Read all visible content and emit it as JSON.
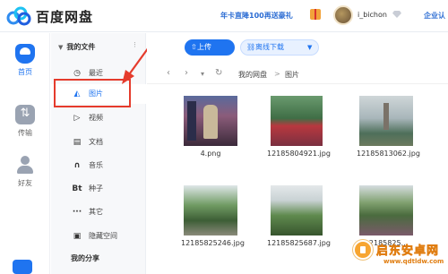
{
  "app": {
    "brand": "百度网盘",
    "promo": "年卡直降100再送豪礼",
    "username": "i_bichon",
    "enterprise": "企业认"
  },
  "rail": {
    "items": [
      {
        "label": "首页",
        "icon": "home-cloud-icon",
        "active": true
      },
      {
        "label": "传输",
        "icon": "transfer-icon",
        "active": false
      },
      {
        "label": "好友",
        "icon": "friends-icon",
        "active": false
      }
    ]
  },
  "nav": {
    "my_files": "我的文件",
    "items": [
      {
        "label": "最近",
        "icon": "clock-icon",
        "glyph": "◷"
      },
      {
        "label": "图片",
        "icon": "picture-icon",
        "glyph": "◭",
        "active": true
      },
      {
        "label": "视频",
        "icon": "play-icon",
        "glyph": "▷"
      },
      {
        "label": "文档",
        "icon": "document-icon",
        "glyph": "▤"
      },
      {
        "label": "音乐",
        "icon": "headphones-icon",
        "glyph": "∩"
      },
      {
        "label": "种子",
        "icon": "bt-icon",
        "glyph": "Bt"
      },
      {
        "label": "其它",
        "icon": "more-icon",
        "glyph": "···"
      },
      {
        "label": "隐藏空间",
        "icon": "lock-icon",
        "glyph": "▣"
      }
    ],
    "my_share": "我的分享"
  },
  "toolbar": {
    "upload": "上传",
    "offline": "离线下载"
  },
  "breadcrumb": {
    "root": "我的网盘",
    "sep": ">",
    "current": "图片"
  },
  "files": [
    {
      "name": "4.png"
    },
    {
      "name": "12185804921.jpg"
    },
    {
      "name": "12185813062.jpg"
    },
    {
      "name": "12185825246.jpg"
    },
    {
      "name": "12185825687.jpg"
    },
    {
      "name": "12185825..."
    }
  ],
  "watermark": {
    "title": "启东安卓网",
    "url": "www.qdtldw.com"
  },
  "colors": {
    "accent": "#1f74f0",
    "highlight": "#e53b2c"
  }
}
